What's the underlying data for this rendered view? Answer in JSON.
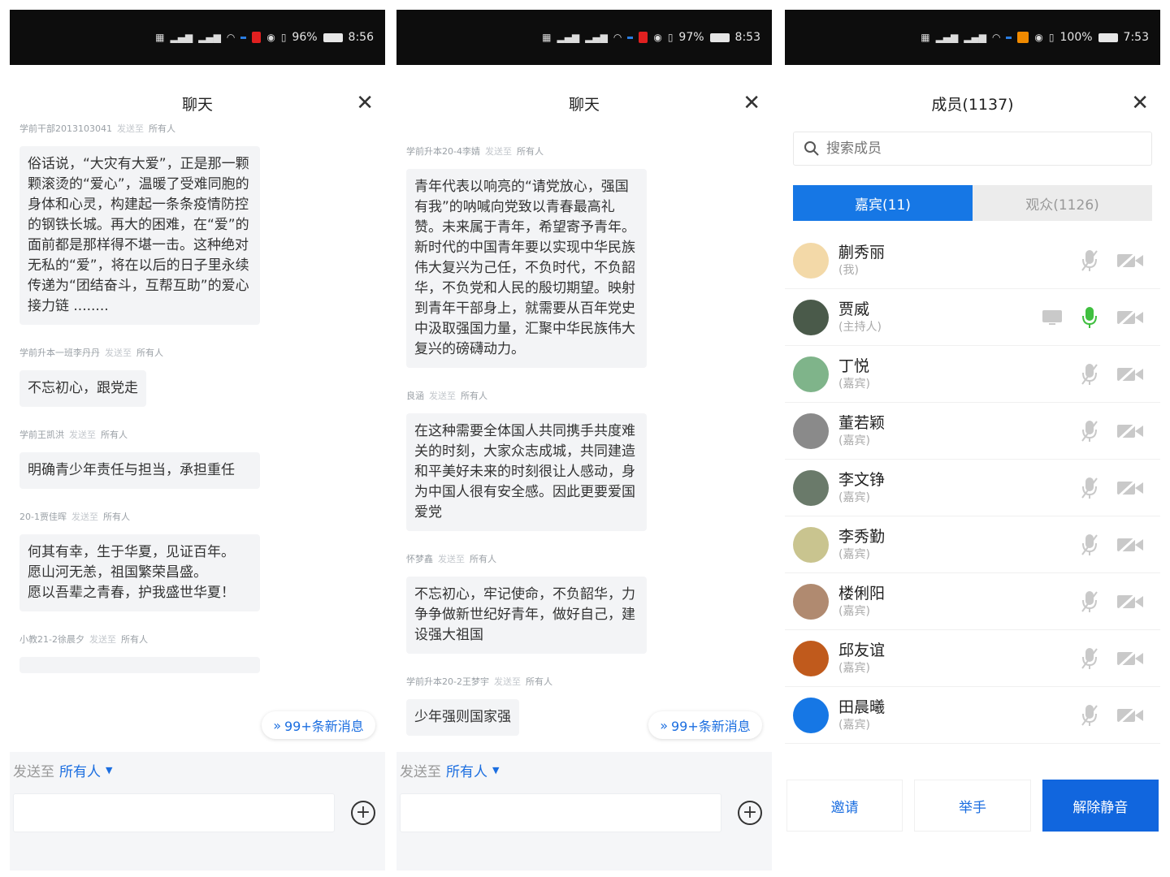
{
  "screens": [
    {
      "status": {
        "battery": "96%",
        "time": "8:56"
      },
      "title": "聊天",
      "messages": [
        {
          "sender": "学前干部2013103041",
          "target": "发送至",
          "to": "所有人",
          "text": "俗话说，“大灾有大爱”，正是那一颗颗滚烫的“爱心”，温暖了受难同胞的身体和心灵，构建起一条条疫情防控的钢铁长城。再大的困难，在“爱”的面前都是那样得不堪一击。这种绝对无私的“爱”，将在以后的日子里永续传递为“团结奋斗，互帮互助”的爱心接力链 ........"
        },
        {
          "sender": "学前升本一班李丹丹",
          "target": "发送至",
          "to": "所有人",
          "text": "不忘初心，跟党走"
        },
        {
          "sender": "学前王凯洪",
          "target": "发送至",
          "to": "所有人",
          "text": "明确青少年责任与担当，承担重任"
        },
        {
          "sender": "20-1贾佳晖",
          "target": "发送至",
          "to": "所有人",
          "text": "何其有幸，生于华夏，见证百年。\n愿山河无恙，祖国繁荣昌盛。\n愿以吾辈之青春，护我盛世华夏！"
        },
        {
          "sender": "小教21-2徐晨夕",
          "target": "发送至",
          "to": "所有人",
          "text": ""
        }
      ],
      "new_messages": "99+条新消息",
      "send_to_label": "发送至",
      "send_to_value": "所有人",
      "input_value": ""
    },
    {
      "status": {
        "battery": "97%",
        "time": "8:53"
      },
      "title": "聊天",
      "messages": [
        {
          "sender": "学前升本20-4李婧",
          "target": "发送至",
          "to": "所有人",
          "text": "青年代表以响亮的“请党放心，强国有我”的呐喊向党致以青春最高礼赞。未来属于青年，希望寄予青年。新时代的中国青年要以实现中华民族伟大复兴为己任，不负时代，不负韶华，不负党和人民的殷切期望。映射到青年干部身上，就需要从百年党史中汲取强国力量，汇聚中华民族伟大复兴的磅礴动力。"
        },
        {
          "sender": "良涵",
          "target": "发送至",
          "to": "所有人",
          "text": "在这种需要全体国人共同携手共度难关的时刻，大家众志成城，共同建造和平美好未来的时刻很让人感动，身为中国人很有安全感。因此更要爱国爱党"
        },
        {
          "sender": "怀梦鑫",
          "target": "发送至",
          "to": "所有人",
          "text": "不忘初心，牢记使命，不负韶华，力争争做新世纪好青年，做好自己，建设强大祖国"
        },
        {
          "sender": "学前升本20-2王梦宇",
          "target": "发送至",
          "to": "所有人",
          "text": "少年强则国家强"
        }
      ],
      "new_messages": "99+条新消息",
      "send_to_label": "发送至",
      "send_to_value": "所有人",
      "input_value": ""
    },
    {
      "status": {
        "battery": "100%",
        "time": "7:53"
      },
      "title": "成员(1137)",
      "search_placeholder": "搜索成员",
      "tabs": [
        {
          "label": "嘉宾(11)",
          "active": true
        },
        {
          "label": "观众(1126)",
          "active": false
        }
      ],
      "members": [
        {
          "name": "蒯秀丽",
          "role": "(我)",
          "avatar_color": "#f3d9a8",
          "screen": false,
          "mic_on": false
        },
        {
          "name": "贾威",
          "role": "(主持人)",
          "avatar_color": "#4a5a4a",
          "screen": true,
          "mic_on": true
        },
        {
          "name": "丁悦",
          "role": "(嘉宾)",
          "avatar_color": "#7fb48a",
          "screen": false,
          "mic_on": false
        },
        {
          "name": "董若颖",
          "role": "(嘉宾)",
          "avatar_color": "#8a8a8a",
          "screen": false,
          "mic_on": false
        },
        {
          "name": "李文铮",
          "role": "(嘉宾)",
          "avatar_color": "#6a7a6a",
          "screen": false,
          "mic_on": false
        },
        {
          "name": "李秀勤",
          "role": "(嘉宾)",
          "avatar_color": "#c9c48f",
          "screen": false,
          "mic_on": false
        },
        {
          "name": "楼俐阳",
          "role": "(嘉宾)",
          "avatar_color": "#b08a70",
          "screen": false,
          "mic_on": false
        },
        {
          "name": "邱友谊",
          "role": "(嘉宾)",
          "avatar_color": "#c05a1c",
          "screen": false,
          "mic_on": false
        },
        {
          "name": "田晨曦",
          "role": "(嘉宾)",
          "avatar_color": "#1677e5",
          "screen": false,
          "mic_on": false
        }
      ],
      "buttons": {
        "invite": "邀请",
        "raise_hand": "举手",
        "unmute": "解除静音"
      }
    }
  ],
  "colors": {
    "accent": "#1677e5",
    "mic_on": "#3fbf3f",
    "muted_icon": "#c9c9c9"
  }
}
